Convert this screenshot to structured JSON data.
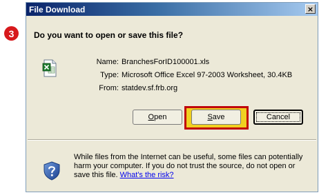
{
  "annotation": {
    "step": "3",
    "color": "#d7191c"
  },
  "dialog": {
    "title": "File Download",
    "close_symbol": "×",
    "question": "Do you want to open or save this file?",
    "file": {
      "icon": "excel-file-icon",
      "name_label": "Name:",
      "name": "BranchesForID100001.xls",
      "type_label": "Type:",
      "type": "Microsoft Office Excel 97-2003 Worksheet, 30.4KB",
      "from_label": "From:",
      "from": "statdev.sf.frb.org"
    },
    "buttons": {
      "open": {
        "mnemonic": "O",
        "rest": "pen"
      },
      "save": {
        "mnemonic": "S",
        "rest": "ave"
      },
      "cancel": "Cancel"
    },
    "highlight_color": "#c0000a",
    "warning": {
      "icon": "shield-question-icon",
      "text": "While files from the Internet can be useful, some files can potentially harm your computer. If you do not trust the source, do not open or save this file. ",
      "link": "What's the risk?"
    }
  }
}
